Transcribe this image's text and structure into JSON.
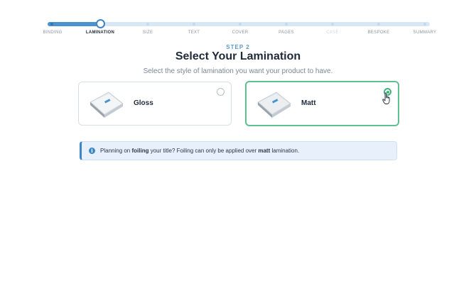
{
  "stepper": {
    "steps": [
      {
        "label": "BINDING",
        "state": "done"
      },
      {
        "label": "LAMINATION",
        "state": "active"
      },
      {
        "label": "SIZE",
        "state": "pending"
      },
      {
        "label": "TEXT",
        "state": "pending"
      },
      {
        "label": "COVER",
        "state": "pending"
      },
      {
        "label": "PAGES",
        "state": "pending"
      },
      {
        "label": "CASE",
        "state": "disabled"
      },
      {
        "label": "BESPOKE",
        "state": "pending"
      },
      {
        "label": "SUMMARY",
        "state": "pending"
      }
    ]
  },
  "header": {
    "step_no": "STEP 2",
    "title": "Select Your Lamination",
    "subtitle": "Select the style of lamination you want your product to have."
  },
  "options": [
    {
      "label": "Gloss",
      "selected": false
    },
    {
      "label": "Matt",
      "selected": true
    }
  ],
  "info": {
    "icon": "info-icon",
    "text_1": "Planning on ",
    "bold_1": "foiling",
    "text_2": " your title? Foiling can only be applied over ",
    "bold_2": "matt",
    "text_3": " lamination."
  },
  "colors": {
    "accent": "#3d86c6",
    "selected": "#3fb37a"
  }
}
